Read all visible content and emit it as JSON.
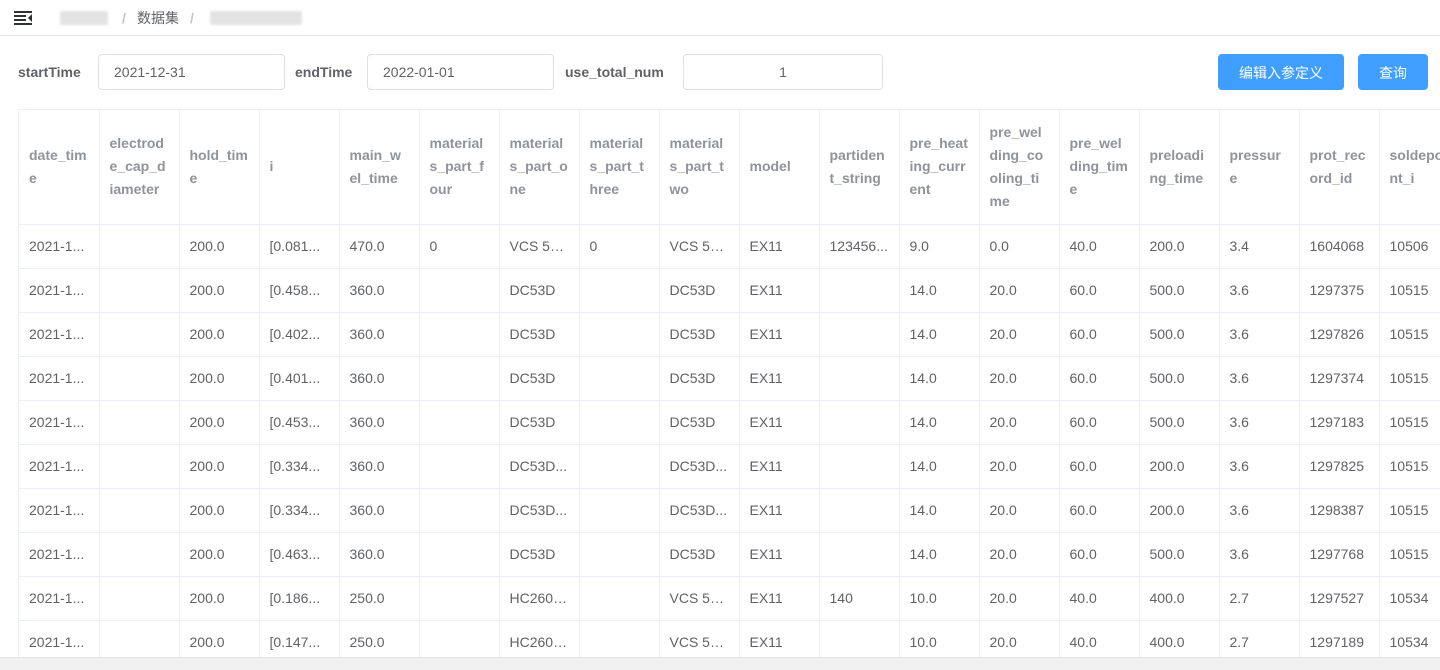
{
  "breadcrumb": {
    "separator": "/",
    "dataset_label": "数据集"
  },
  "filters": {
    "start_label": "startTime",
    "start_value": "2021-12-31",
    "end_label": "endTime",
    "end_value": "2022-01-01",
    "num_label": "use_total_num",
    "num_value": "1"
  },
  "buttons": {
    "edit_label": "编辑入参定义",
    "query_label": "查询"
  },
  "colors": {
    "primary": "#409eff",
    "header_text": "#909399",
    "cell_text": "#606266",
    "border": "#ebeef5"
  },
  "table": {
    "columns": [
      "date_time",
      "electrode_cap_diameter",
      "hold_time",
      "i",
      "main_wel_time",
      "materials_part_four",
      "materials_part_one",
      "materials_part_three",
      "materials_part_two",
      "model",
      "partident_string",
      "pre_heating_current",
      "pre_welding_cooling_time",
      "pre_welding_time",
      "preloading_time",
      "pressure",
      "prot_record_id",
      "soldepoint_i"
    ],
    "rows": [
      [
        "2021-1...",
        "",
        "200.0",
        "[0.081...",
        "470.0",
        "0",
        "VCS 57...",
        "0",
        "VCS 57...",
        "EX11",
        "123456...",
        "9.0",
        "0.0",
        "40.0",
        "200.0",
        "3.4",
        "1604068",
        "10506"
      ],
      [
        "2021-1...",
        "",
        "200.0",
        "[0.458...",
        "360.0",
        "",
        "DC53D",
        "",
        "DC53D",
        "EX11",
        "",
        "14.0",
        "20.0",
        "60.0",
        "500.0",
        "3.6",
        "1297375",
        "10515"
      ],
      [
        "2021-1...",
        "",
        "200.0",
        "[0.402...",
        "360.0",
        "",
        "DC53D",
        "",
        "DC53D",
        "EX11",
        "",
        "14.0",
        "20.0",
        "60.0",
        "500.0",
        "3.6",
        "1297826",
        "10515"
      ],
      [
        "2021-1...",
        "",
        "200.0",
        "[0.401...",
        "360.0",
        "",
        "DC53D",
        "",
        "DC53D",
        "EX11",
        "",
        "14.0",
        "20.0",
        "60.0",
        "500.0",
        "3.6",
        "1297374",
        "10515"
      ],
      [
        "2021-1...",
        "",
        "200.0",
        "[0.453...",
        "360.0",
        "",
        "DC53D",
        "",
        "DC53D",
        "EX11",
        "",
        "14.0",
        "20.0",
        "60.0",
        "500.0",
        "3.6",
        "1297183",
        "10515"
      ],
      [
        "2021-1...",
        "",
        "200.0",
        "[0.334...",
        "360.0",
        "",
        "DC53D...",
        "",
        "DC53D...",
        "EX11",
        "",
        "14.0",
        "20.0",
        "60.0",
        "200.0",
        "3.6",
        "1297825",
        "10515"
      ],
      [
        "2021-1...",
        "",
        "200.0",
        "[0.334...",
        "360.0",
        "",
        "DC53D...",
        "",
        "DC53D...",
        "EX11",
        "",
        "14.0",
        "20.0",
        "60.0",
        "200.0",
        "3.6",
        "1298387",
        "10515"
      ],
      [
        "2021-1...",
        "",
        "200.0",
        "[0.463...",
        "360.0",
        "",
        "DC53D",
        "",
        "DC53D",
        "EX11",
        "",
        "14.0",
        "20.0",
        "60.0",
        "500.0",
        "3.6",
        "1297768",
        "10515"
      ],
      [
        "2021-1...",
        "",
        "200.0",
        "[0.186...",
        "250.0",
        "",
        "HC260LA",
        "",
        "VCS 57...",
        "EX11",
        "140",
        "10.0",
        "20.0",
        "40.0",
        "400.0",
        "2.7",
        "1297527",
        "10534"
      ],
      [
        "2021-1...",
        "",
        "200.0",
        "[0.147...",
        "250.0",
        "",
        "HC260LA",
        "",
        "VCS 57...",
        "EX11",
        "",
        "10.0",
        "20.0",
        "40.0",
        "400.0",
        "2.7",
        "1297189",
        "10534"
      ]
    ]
  }
}
